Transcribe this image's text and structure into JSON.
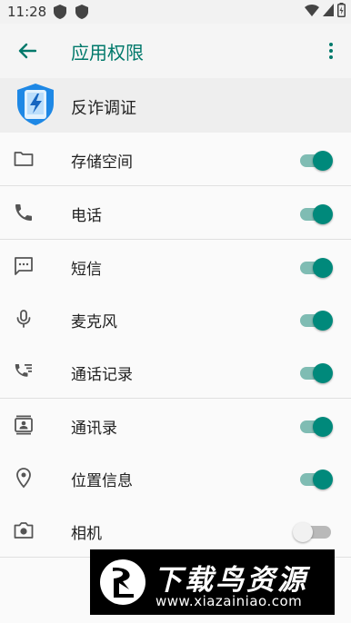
{
  "status_bar": {
    "time": "11:28"
  },
  "app_bar": {
    "title": "应用权限"
  },
  "app": {
    "name": "反诈调证"
  },
  "permissions": [
    {
      "label": "存储空间",
      "icon": "folder-icon",
      "enabled": true
    },
    {
      "label": "电话",
      "icon": "phone-icon",
      "enabled": true
    },
    {
      "label": "短信",
      "icon": "sms-icon",
      "enabled": true
    },
    {
      "label": "麦克风",
      "icon": "microphone-icon",
      "enabled": true
    },
    {
      "label": "通话记录",
      "icon": "call-log-icon",
      "enabled": true
    },
    {
      "label": "通讯录",
      "icon": "contacts-icon",
      "enabled": true
    },
    {
      "label": "位置信息",
      "icon": "location-icon",
      "enabled": true
    },
    {
      "label": "相机",
      "icon": "camera-icon",
      "enabled": false
    }
  ],
  "watermark": {
    "title": "下载鸟资源",
    "url": "www.xiazainiao.com"
  },
  "colors": {
    "accent": "#00796b",
    "switch_on": "#00897b",
    "switch_track_on": "#7fbcb3",
    "switch_off": "#f1f1f1"
  }
}
